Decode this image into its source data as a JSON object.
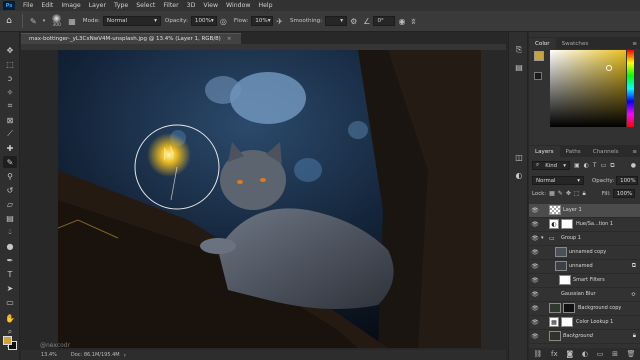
{
  "menubar": {
    "logo": "Ps",
    "items": [
      "File",
      "Edit",
      "Image",
      "Layer",
      "Type",
      "Select",
      "Filter",
      "3D",
      "View",
      "Window",
      "Help"
    ]
  },
  "options_bar": {
    "brush_size": "300",
    "mode_label": "Mode:",
    "mode_value": "Normal",
    "opacity_label": "Opacity:",
    "opacity_value": "100%",
    "flow_label": "Flow:",
    "flow_value": "10%",
    "smoothing_label": "Smoothing:",
    "smoothing_value": "",
    "angle_value": "0°"
  },
  "document": {
    "tab_title": "max-bottinger-_yL3CxNwV4M-unsplash.jpg @ 13.4% (Layer 1, RGB/8)",
    "tab_close": "×",
    "status_zoom": "13.4%",
    "status_doc": "Doc: 86.1M/195.4M",
    "watermark": "@nexcodr"
  },
  "color_panel": {
    "tabs": [
      "Color",
      "Swatches"
    ],
    "foreground": "#c9a43a",
    "background": "#1a1a1a"
  },
  "layers_panel": {
    "tabs": [
      "Layers",
      "Paths",
      "Channels"
    ],
    "kind_label": "Kind",
    "blend_mode": "Normal",
    "opacity_label": "Opacity:",
    "opacity_value": "100%",
    "lock_label": "Lock:",
    "fill_label": "Fill:",
    "fill_value": "100%",
    "layers": [
      {
        "name": "Layer 1",
        "selected": true,
        "thumb": "checker",
        "mask": false
      },
      {
        "name": "Hue/Sa...tion 1",
        "selected": false,
        "thumb": "adjust",
        "mask": true
      },
      {
        "name": "Group 1",
        "selected": false,
        "thumb": "folder",
        "mask": false
      },
      {
        "name": "unnamed copy",
        "selected": false,
        "thumb": "photo",
        "mask": false
      },
      {
        "name": "unnamed",
        "selected": false,
        "thumb": "photo",
        "mask": false
      },
      {
        "name": "Smart Filters",
        "selected": false,
        "thumb": "white",
        "mask": false
      },
      {
        "name": "Gaussian Blur",
        "selected": false,
        "thumb": "none",
        "mask": false
      },
      {
        "name": "Background copy",
        "selected": false,
        "thumb": "photo",
        "mask": true
      },
      {
        "name": "Color Lookup 1",
        "selected": false,
        "thumb": "adjust",
        "mask": true
      },
      {
        "name": "Background",
        "selected": false,
        "thumb": "photo",
        "mask": false
      }
    ]
  },
  "colors": {
    "ui_dark": "#282828",
    "panel": "#323232",
    "accent_gold": "#c9a43a",
    "selected_row": "#4c4c4c"
  }
}
